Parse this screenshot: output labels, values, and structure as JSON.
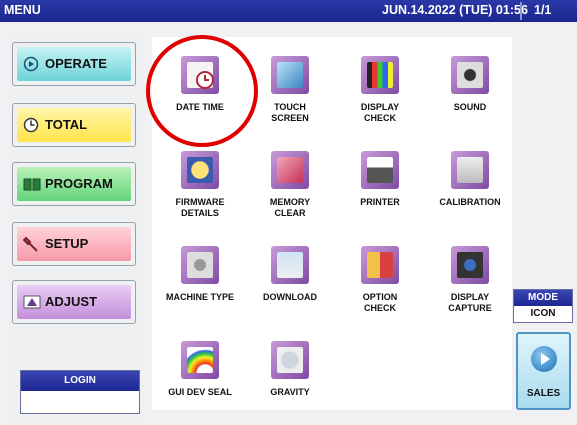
{
  "header": {
    "title": "MENU",
    "datetime": "JUN.14.2022 (TUE) 01:56",
    "page": "1/1"
  },
  "menu_buttons": [
    {
      "label": "OPERATE",
      "icon": "play-circle-icon"
    },
    {
      "label": "TOTAL",
      "icon": "clock-icon"
    },
    {
      "label": "PROGRAM",
      "icon": "book-icon"
    },
    {
      "label": "SETUP",
      "icon": "wrench-icon"
    },
    {
      "label": "ADJUST",
      "icon": "adjust-icon"
    }
  ],
  "items": [
    {
      "line1": "DATE TIME",
      "line2": "",
      "icon": "calendar-clock-icon"
    },
    {
      "line1": "TOUCH",
      "line2": "SCREEN",
      "icon": "monitor-icon"
    },
    {
      "line1": "DISPLAY",
      "line2": "CHECK",
      "icon": "color-bars-icon"
    },
    {
      "line1": "SOUND",
      "line2": "",
      "icon": "speaker-icon"
    },
    {
      "line1": "FIRMWARE",
      "line2": "DETAILS",
      "icon": "info-icon"
    },
    {
      "line1": "MEMORY",
      "line2": "CLEAR",
      "icon": "eraser-icon"
    },
    {
      "line1": "PRINTER",
      "line2": "",
      "icon": "printer-icon"
    },
    {
      "line1": "CALIBRATION",
      "line2": "",
      "icon": "weight-icon"
    },
    {
      "line1": "MACHINE TYPE",
      "line2": "",
      "icon": "gears-icon"
    },
    {
      "line1": "DOWNLOAD",
      "line2": "",
      "icon": "download-box-icon"
    },
    {
      "line1": "OPTION",
      "line2": "CHECK",
      "icon": "option-check-icon"
    },
    {
      "line1": "DISPLAY",
      "line2": "CAPTURE",
      "icon": "camera-icon"
    },
    {
      "line1": "GUI DEV SEAL",
      "line2": "",
      "icon": "rainbow-icon"
    },
    {
      "line1": "GRAVITY",
      "line2": "",
      "icon": "globe-weight-icon"
    }
  ],
  "login": {
    "label": "LOGIN",
    "value": ""
  },
  "mode": {
    "label": "MODE",
    "value": "ICON"
  },
  "sales": {
    "label": "SALES",
    "icon": "play-arrow-icon"
  },
  "highlight": {
    "target": "DATE TIME",
    "color": "#e00000"
  }
}
